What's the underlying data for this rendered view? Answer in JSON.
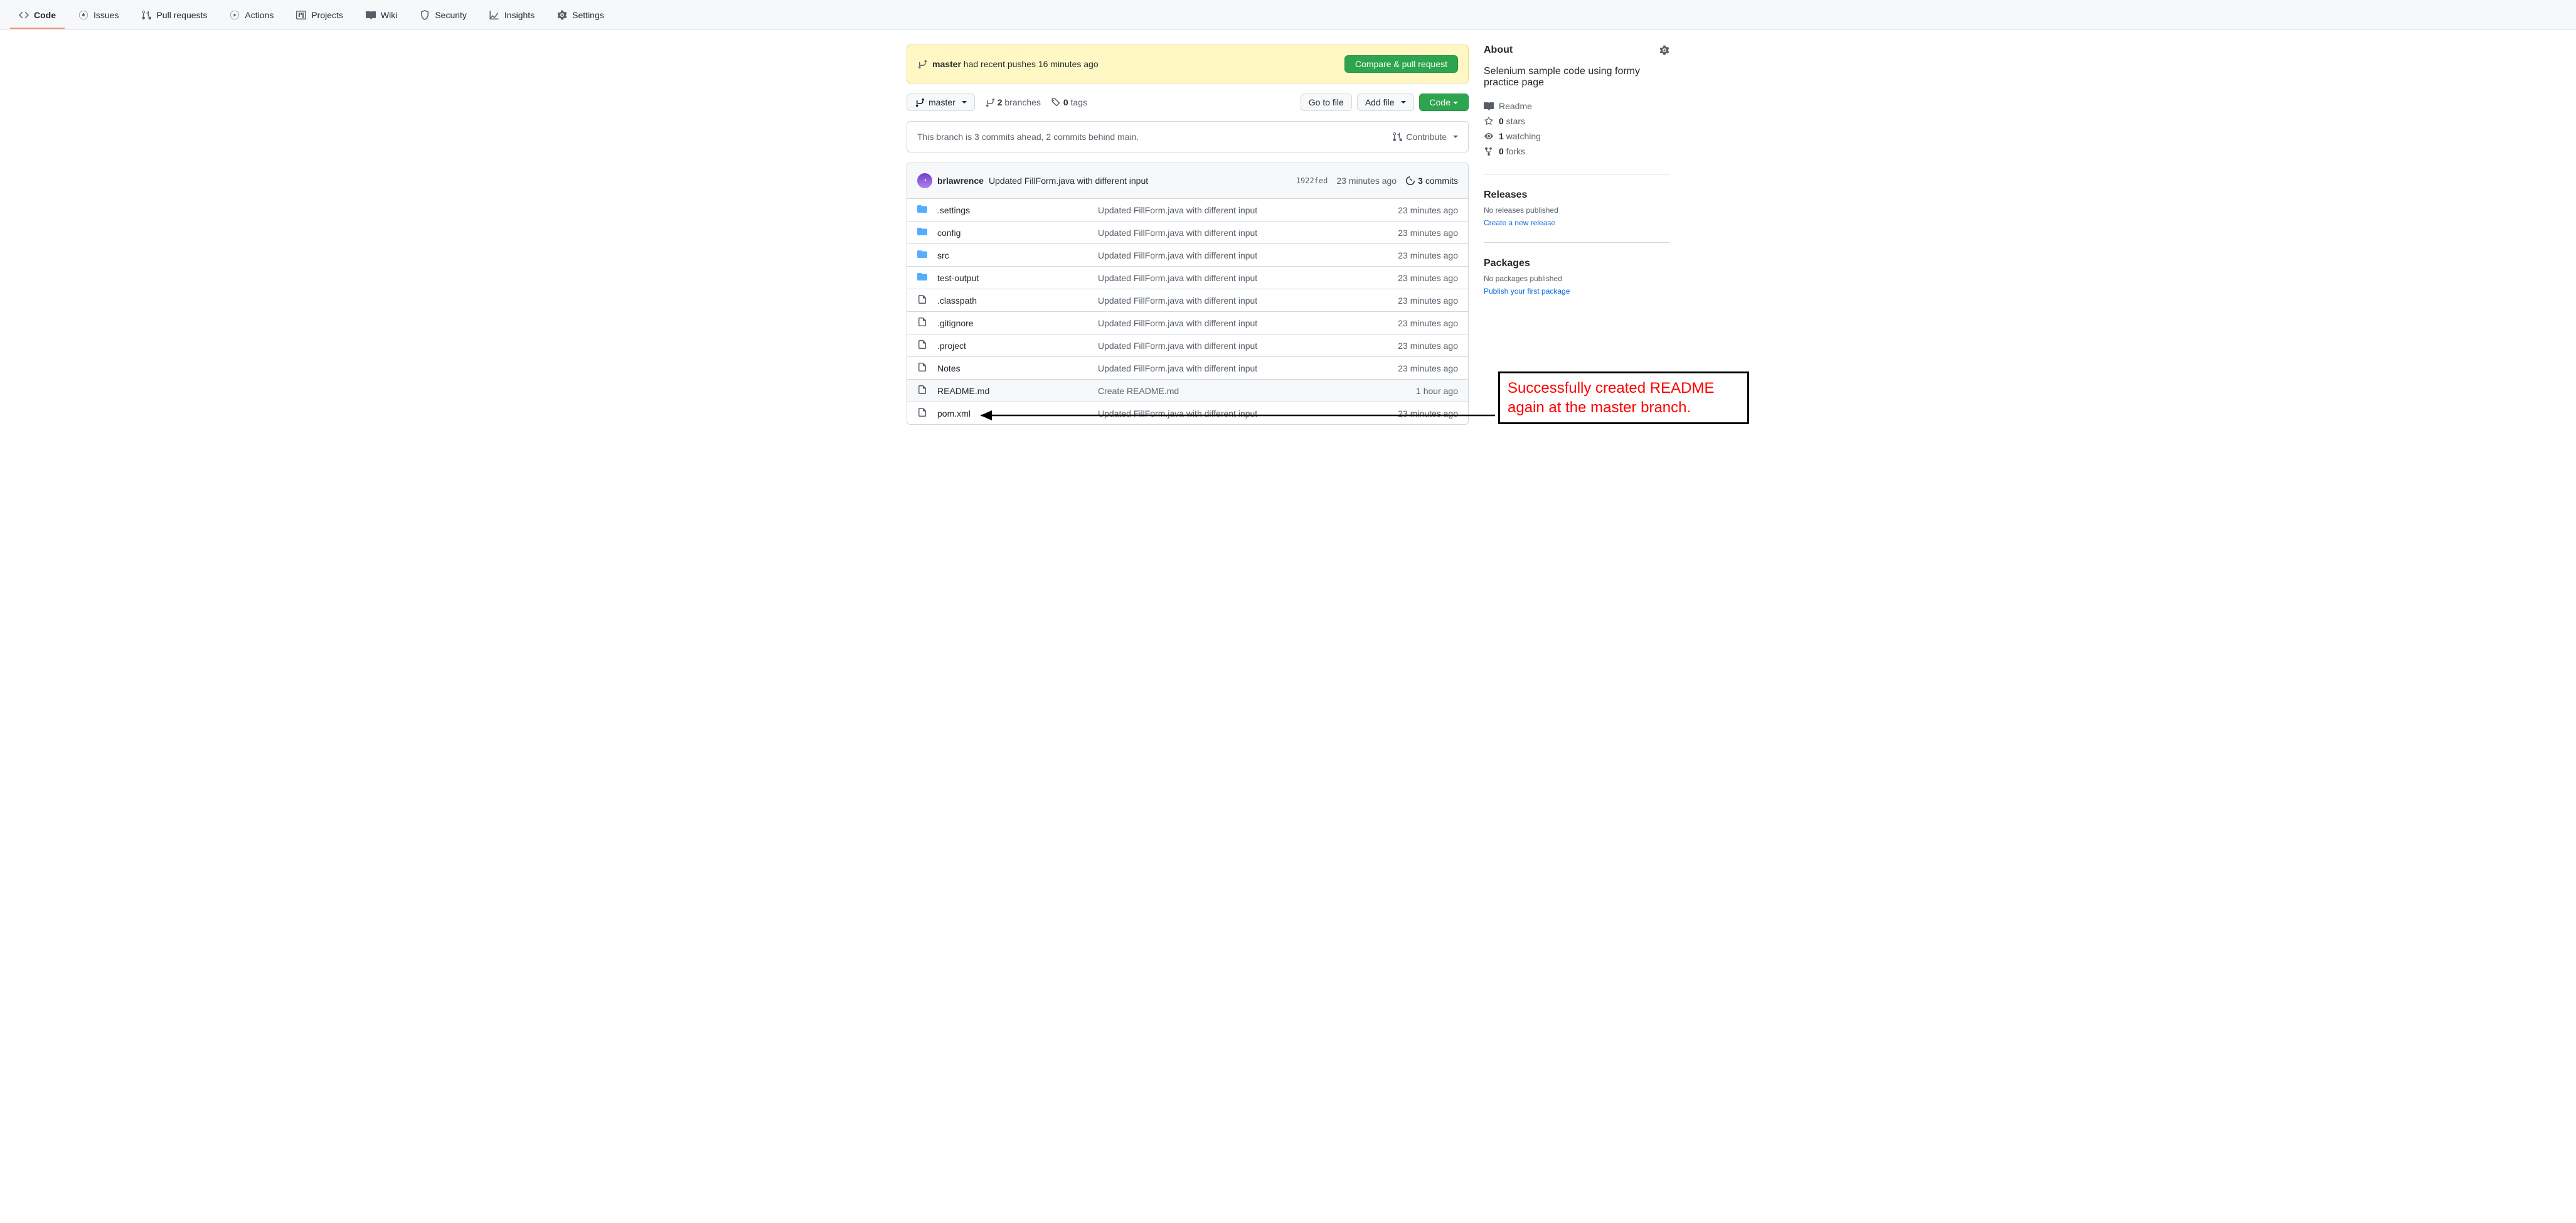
{
  "nav": {
    "code": "Code",
    "issues": "Issues",
    "pulls": "Pull requests",
    "actions": "Actions",
    "projects": "Projects",
    "wiki": "Wiki",
    "security": "Security",
    "insights": "Insights",
    "settings": "Settings"
  },
  "flash": {
    "branch": "master",
    "text": " had recent pushes 16 minutes ago",
    "button": "Compare & pull request"
  },
  "branch_select": {
    "label": "master",
    "branches_count": "2",
    "branches_label": " branches",
    "tags_count": "0",
    "tags_label": " tags"
  },
  "buttons": {
    "goto": "Go to file",
    "addfile": "Add file",
    "code": "Code"
  },
  "status": {
    "text": "This branch is 3 commits ahead, 2 commits behind main.",
    "contribute": "Contribute"
  },
  "latest_commit": {
    "author": "brlawrence",
    "message": "Updated FillForm.java with different input",
    "sha": "1922fed",
    "age": "23 minutes ago",
    "commits_count": "3",
    "commits_label": " commits"
  },
  "files": [
    {
      "type": "dir",
      "name": ".settings",
      "msg": "Updated FillForm.java with different input",
      "age": "23 minutes ago",
      "hl": false
    },
    {
      "type": "dir",
      "name": "config",
      "msg": "Updated FillForm.java with different input",
      "age": "23 minutes ago",
      "hl": false
    },
    {
      "type": "dir",
      "name": "src",
      "msg": "Updated FillForm.java with different input",
      "age": "23 minutes ago",
      "hl": false
    },
    {
      "type": "dir",
      "name": "test-output",
      "msg": "Updated FillForm.java with different input",
      "age": "23 minutes ago",
      "hl": false
    },
    {
      "type": "file",
      "name": ".classpath",
      "msg": "Updated FillForm.java with different input",
      "age": "23 minutes ago",
      "hl": false
    },
    {
      "type": "file",
      "name": ".gitignore",
      "msg": "Updated FillForm.java with different input",
      "age": "23 minutes ago",
      "hl": false
    },
    {
      "type": "file",
      "name": ".project",
      "msg": "Updated FillForm.java with different input",
      "age": "23 minutes ago",
      "hl": false
    },
    {
      "type": "file",
      "name": "Notes",
      "msg": "Updated FillForm.java with different input",
      "age": "23 minutes ago",
      "hl": false
    },
    {
      "type": "file",
      "name": "README.md",
      "msg": "Create README.md",
      "age": "1 hour ago",
      "hl": true
    },
    {
      "type": "file",
      "name": "pom.xml",
      "msg": "Updated FillForm.java with different input",
      "age": "23 minutes ago",
      "hl": false
    }
  ],
  "about": {
    "heading": "About",
    "description": "Selenium sample code using formy practice page",
    "readme": "Readme",
    "stars_count": "0",
    "stars_label": " stars",
    "watching_count": "1",
    "watching_label": " watching",
    "forks_count": "0",
    "forks_label": " forks"
  },
  "releases": {
    "heading": "Releases",
    "none": "No releases published",
    "link": "Create a new release"
  },
  "packages": {
    "heading": "Packages",
    "none": "No packages published",
    "link": "Publish your first package"
  },
  "annotation": {
    "text": "Successfully created README again at the master branch."
  }
}
